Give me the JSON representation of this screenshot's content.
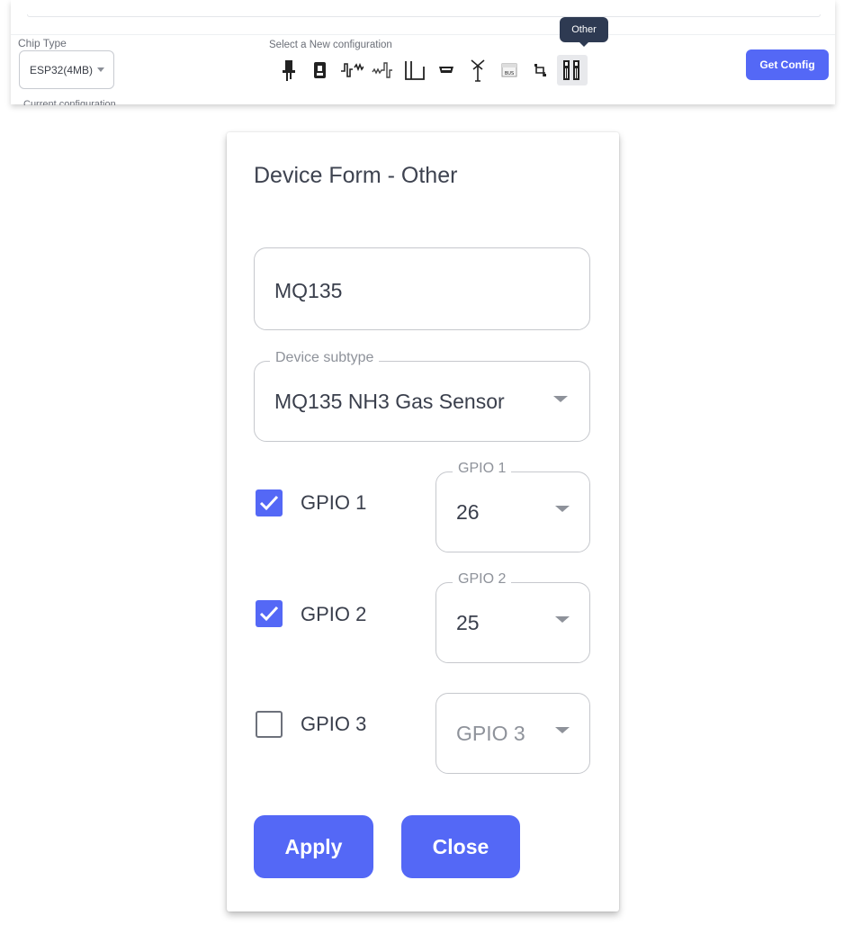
{
  "toolbar": {
    "chip_type_label": "Chip Type",
    "chip_type_value": "ESP32(4MB)",
    "config_label": "Select a New configuration",
    "tooltip": "Other",
    "get_config_label": "Get Config",
    "cut_text": "Current configuration",
    "icons": [
      "led-icon",
      "relay-icon",
      "pwm-icon",
      "analog-icon",
      "switch-icon",
      "display-icon",
      "antenna-icon",
      "bus-icon",
      "i2c-icon",
      "other-icon"
    ],
    "active_icon": "other-icon",
    "accent_color": "#5468f6"
  },
  "dialog": {
    "title": "Device Form - Other",
    "name_value": "MQ135",
    "subtype_label": "Device subtype",
    "subtype_value": "MQ135 NH3 Gas Sensor",
    "gpios": [
      {
        "label": "GPIO 1",
        "checked": true,
        "select_label": "GPIO 1",
        "value": "26"
      },
      {
        "label": "GPIO 2",
        "checked": true,
        "select_label": "GPIO 2",
        "value": "25"
      },
      {
        "label": "GPIO 3",
        "checked": false,
        "select_label": "",
        "value": "GPIO 3"
      }
    ],
    "apply_label": "Apply",
    "close_label": "Close"
  }
}
